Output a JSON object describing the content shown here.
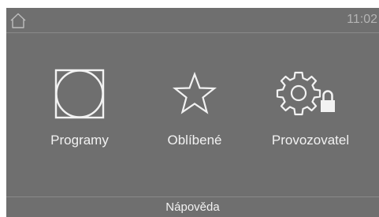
{
  "status_bar": {
    "home_icon": "house-outline-icon",
    "time": "11:02"
  },
  "tiles": [
    {
      "label": "Programy",
      "icon": "drum-program-icon"
    },
    {
      "label": "Oblíbené",
      "icon": "star-outline-icon"
    },
    {
      "label": "Provozovatel",
      "icon": "gear-lock-icon"
    }
  ],
  "footer": {
    "help_label": "Nápověda"
  },
  "colors": {
    "screen_background": "#6f6f6f",
    "text": "#f2f2f2",
    "clock": "#b4b4b4"
  }
}
